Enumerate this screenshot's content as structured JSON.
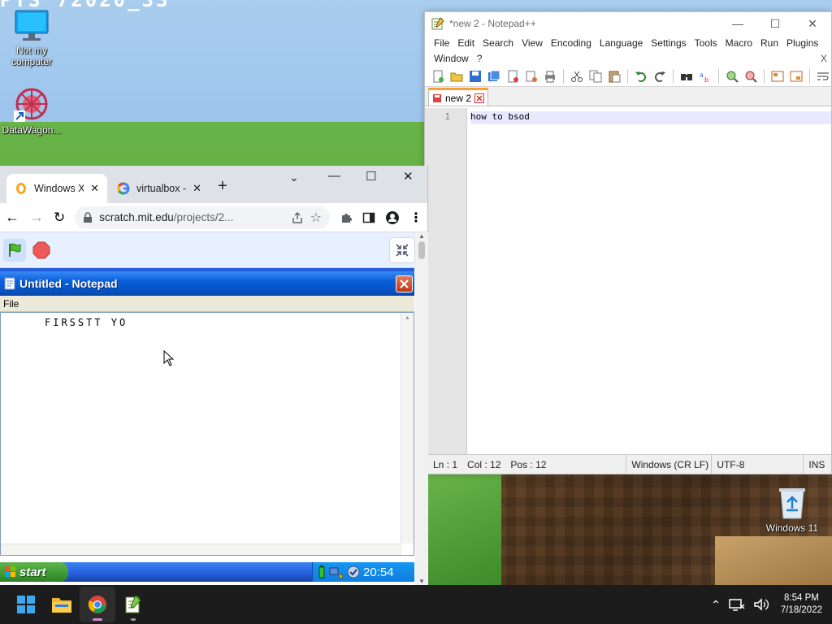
{
  "desktop": {
    "top_fragment": "PTS 72020_33",
    "icons": [
      {
        "label": "Not my computer",
        "icon": "monitor-icon"
      },
      {
        "label": "DataWagon...",
        "icon": "datawagon-icon"
      },
      {
        "label": "Windows 11",
        "icon": "recycle-bin-icon"
      }
    ]
  },
  "notepadpp": {
    "title": "*new 2 - Notepad++",
    "menu": [
      "File",
      "Edit",
      "Search",
      "View",
      "Encoding",
      "Language",
      "Settings",
      "Tools",
      "Macro",
      "Run",
      "Plugins",
      "Window",
      "?"
    ],
    "menu_close": "X",
    "tab_label": "new 2",
    "line_number": "1",
    "code_line": "how to bsod",
    "status": {
      "ln": "Ln : 1",
      "col": "Col : 12",
      "pos": "Pos : 12",
      "eol": "Windows (CR LF)",
      "encoding": "UTF-8",
      "mode": "INS"
    }
  },
  "chrome": {
    "tabs": [
      {
        "label": "Windows X",
        "icon": "scratch-favicon-icon"
      },
      {
        "label": "virtualbox -",
        "icon": "google-favicon-icon"
      }
    ],
    "url_host": "scratch.mit.edu",
    "url_path": "/projects/2..."
  },
  "xp": {
    "window_title": "Untitled - Notepad",
    "menu_file": "File",
    "body_text": "FIRSSTT YO",
    "start_label": "start",
    "clock": "20:54"
  },
  "taskbar": {
    "time": "8:54 PM",
    "date": "7/18/2022"
  },
  "colors": {
    "xp_title_blue": "#0a5fd8",
    "xp_start_green": "#3d9a33",
    "npp_tab_accent": "#f7a033",
    "w11_taskbar": "#1c1c1c"
  }
}
